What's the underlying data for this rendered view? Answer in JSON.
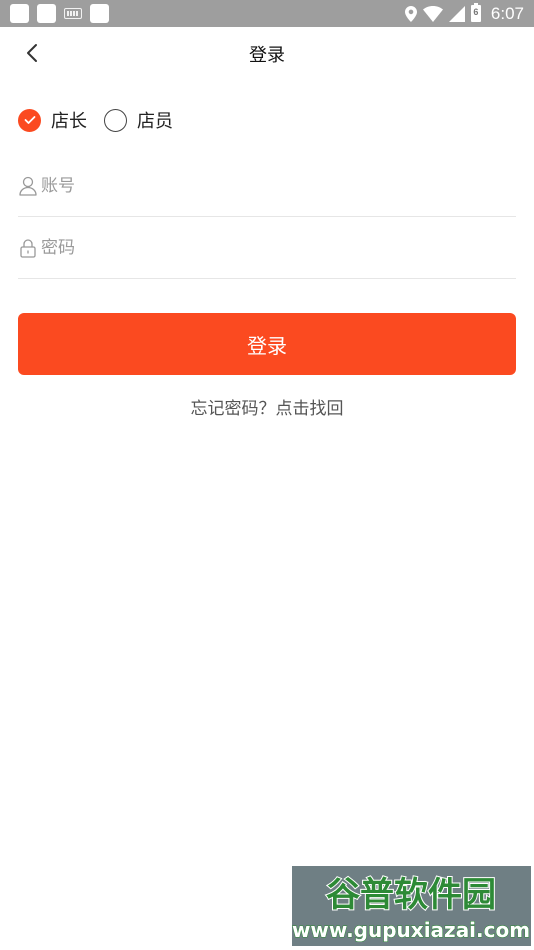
{
  "status_bar": {
    "time": "6:07",
    "battery_level": "6"
  },
  "header": {
    "title": "登录"
  },
  "roles": [
    {
      "label": "店长",
      "checked": true
    },
    {
      "label": "店员",
      "checked": false
    }
  ],
  "form": {
    "account": {
      "value": "",
      "placeholder": "账号"
    },
    "password": {
      "value": "",
      "placeholder": "密码"
    }
  },
  "login_button_label": "登录",
  "forgot_password_label": "忘记密码？点击找回",
  "watermark": {
    "logo_text": "谷普软件园",
    "url": "www.gupuxiazai.com"
  },
  "colors": {
    "accent": "#fb4a20",
    "status_bar": "#9e9e9e"
  }
}
